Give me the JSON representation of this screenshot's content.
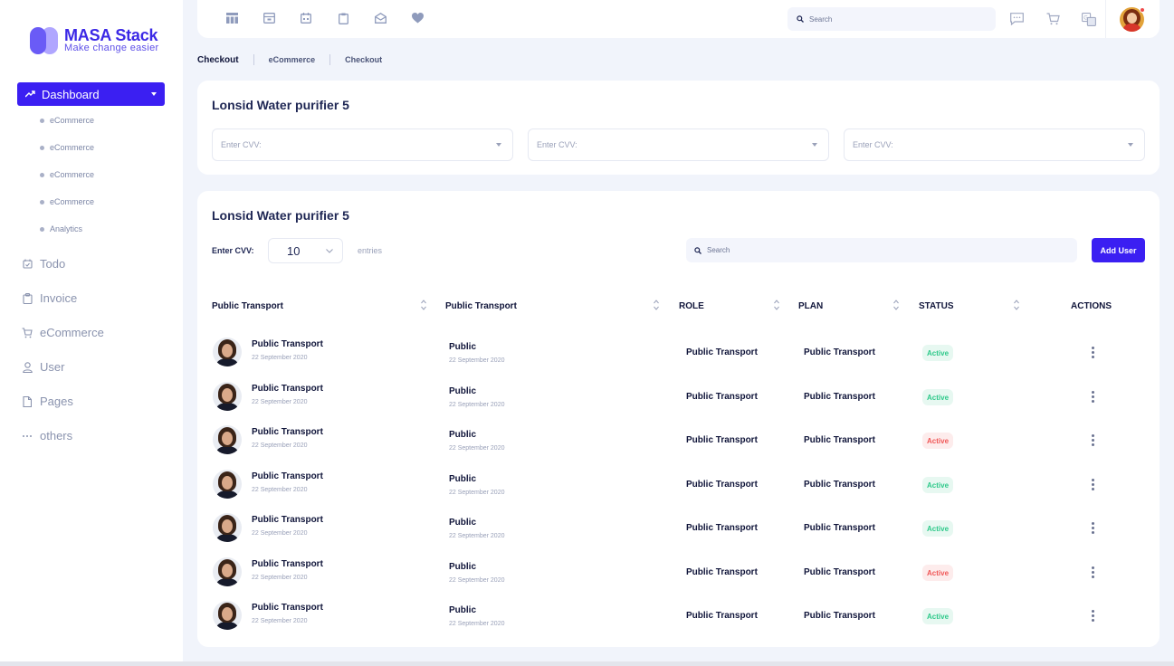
{
  "brand": {
    "name": "MASA Stack",
    "tagline": "Make change easier",
    "accent": "#3b1ff2"
  },
  "sidebar": {
    "active": {
      "label": "Dashboard",
      "icon": "trend-icon"
    },
    "sub_items": [
      "eCommerce",
      "eCommerce",
      "eCommerce",
      "eCommerce",
      "Analytics"
    ],
    "items": [
      {
        "label": "Todo",
        "icon": "calendar-check-icon"
      },
      {
        "label": "Invoice",
        "icon": "clipboard-icon"
      },
      {
        "label": "eCommerce",
        "icon": "cart-icon"
      },
      {
        "label": "User",
        "icon": "user-icon"
      },
      {
        "label": "Pages",
        "icon": "file-icon"
      },
      {
        "label": "others",
        "icon": "more-icon"
      }
    ]
  },
  "topbar": {
    "icons": [
      "layout-icon",
      "store-icon",
      "calendar-icon",
      "clipboard-icon",
      "mail-icon",
      "heart-icon"
    ],
    "search_placeholder": "Search",
    "right_icons": [
      "chat-icon",
      "cart-icon",
      "translate-icon"
    ]
  },
  "breadcrumb": {
    "current": "Checkout",
    "items": [
      "eCommerce",
      "Checkout"
    ]
  },
  "card1": {
    "title": "Lonsid Water purifier 5",
    "selects": [
      "Enter CVV:",
      "Enter CVV:",
      "Enter CVV:"
    ]
  },
  "card2": {
    "title": "Lonsid Water purifier 5",
    "entries_label": "Enter CVV:",
    "entries_value": "10",
    "entries_suffix": "entries",
    "search_placeholder": "Search",
    "add_button": "Add User",
    "headers": [
      "Public Transport",
      "Public Transport",
      "ROLE",
      "PLAN",
      "STATUS",
      "ACTIONS"
    ],
    "rows": [
      {
        "name": "Public Transport",
        "date": "22 September 2020",
        "col2": "Public",
        "col2_date": "22 September 2020",
        "role": "Public Transport",
        "plan": "Public Transport",
        "status": "Active",
        "status_tone": "green"
      },
      {
        "name": "Public Transport",
        "date": "22 September 2020",
        "col2": "Public",
        "col2_date": "22 September 2020",
        "role": "Public Transport",
        "plan": "Public Transport",
        "status": "Active",
        "status_tone": "green"
      },
      {
        "name": "Public Transport",
        "date": "22 September 2020",
        "col2": "Public",
        "col2_date": "22 September 2020",
        "role": "Public Transport",
        "plan": "Public Transport",
        "status": "Active",
        "status_tone": "red"
      },
      {
        "name": "Public Transport",
        "date": "22 September 2020",
        "col2": "Public",
        "col2_date": "22 September 2020",
        "role": "Public Transport",
        "plan": "Public Transport",
        "status": "Active",
        "status_tone": "green"
      },
      {
        "name": "Public Transport",
        "date": "22 September 2020",
        "col2": "Public",
        "col2_date": "22 September 2020",
        "role": "Public Transport",
        "plan": "Public Transport",
        "status": "Active",
        "status_tone": "green"
      },
      {
        "name": "Public Transport",
        "date": "22 September 2020",
        "col2": "Public",
        "col2_date": "22 September 2020",
        "role": "Public Transport",
        "plan": "Public Transport",
        "status": "Active",
        "status_tone": "red"
      },
      {
        "name": "Public Transport",
        "date": "22 September 2020",
        "col2": "Public",
        "col2_date": "22 September 2020",
        "role": "Public Transport",
        "plan": "Public Transport",
        "status": "Active",
        "status_tone": "green"
      }
    ]
  }
}
